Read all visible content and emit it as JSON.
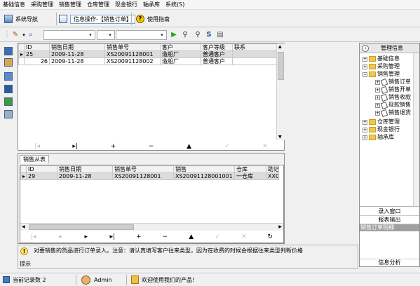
{
  "menu": [
    "基础信息",
    "采购管理",
    "销售管理",
    "仓库管理",
    "现金银行",
    "轴承库",
    "系统(S)"
  ],
  "nav": {
    "system_nav": "系统导航",
    "info_tab": "信息操作-【销售订单】",
    "help": "使用指南"
  },
  "master_grid": {
    "columns": [
      "ID",
      "销售日期",
      "销售单号",
      "客户",
      "客户等级",
      "联系"
    ],
    "rows": [
      [
        "25",
        "2009-11-28",
        "XS20091128001",
        "造船厂",
        "普通客户",
        ""
      ],
      [
        "26",
        "2009-11-28",
        "XS20091128002",
        "造船厂",
        "普通客户",
        ""
      ]
    ]
  },
  "detail": {
    "tab": "销售从表",
    "columns": [
      "ID",
      "销售日期",
      "销售单号",
      "销售",
      "仓库",
      "助记"
    ],
    "rows": [
      [
        "29",
        "2009-11-28",
        "XS20091128001",
        "XS20091128001001",
        "一仓库",
        "XXG"
      ]
    ]
  },
  "tip": {
    "text": "对要销售的货品进行订单录入。注意：请认真填写客户往来类型，因为在收费的时候会根据往来类型判断价格",
    "label": "提示"
  },
  "right": {
    "header": "管理信息",
    "tree": [
      {
        "label": "基础信息",
        "type": "folder",
        "level": 0
      },
      {
        "label": "采购管理",
        "type": "folder",
        "level": 0
      },
      {
        "label": "销售管理",
        "type": "folder",
        "level": 0
      },
      {
        "label": "销售订单",
        "type": "doc",
        "level": 1
      },
      {
        "label": "销售开单",
        "type": "doc",
        "level": 1
      },
      {
        "label": "销售收款",
        "type": "doc",
        "level": 1
      },
      {
        "label": "现款销售",
        "type": "doc",
        "level": 1
      },
      {
        "label": "销售退货",
        "type": "doc",
        "level": 1
      },
      {
        "label": "仓库管理",
        "type": "folder",
        "level": 0
      },
      {
        "label": "现金银行",
        "type": "folder",
        "level": 0
      },
      {
        "label": "轴承库",
        "type": "folder",
        "level": 0
      }
    ],
    "list": [
      "录入窗口",
      "报表输出",
      "销售订单明细"
    ],
    "info_analysis": "信息分析"
  },
  "status": {
    "records_label": "当前记录数 2",
    "user": "Admin",
    "welcome": "欢迎使用我们的产品!"
  }
}
